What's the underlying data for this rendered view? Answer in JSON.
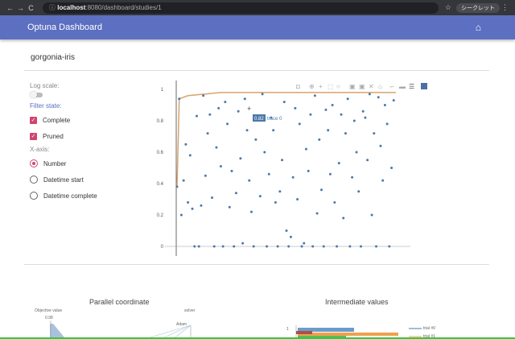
{
  "browser": {
    "url_host": "localhost",
    "url_rest": ":8080/dashboard/studies/1",
    "profile": "シークレット"
  },
  "appbar": {
    "title": "Optuna Dashboard",
    "home_icon": "home-icon"
  },
  "study": {
    "name": "gorgonia-iris"
  },
  "controls": {
    "log_scale_label": "Log scale:",
    "filter_label": "Filter state:",
    "complete": "Complete",
    "pruned": "Pruned",
    "xaxis_label": "X-axis:",
    "xaxis_options": [
      "Number",
      "Datetime start",
      "Datetime complete"
    ],
    "selected_xaxis": "Number"
  },
  "chart_data": {
    "type": "scatter",
    "title": "",
    "ylim": [
      0,
      1
    ],
    "xlim": [
      0,
      100
    ],
    "yticks": [
      "0",
      "0.2",
      "0.4",
      "0.6",
      "0.8",
      "1"
    ],
    "hover": {
      "value": "0.82",
      "trace": "trace 0"
    },
    "best_line": {
      "x": [
        0,
        1,
        5,
        20,
        100
      ],
      "y": [
        0.38,
        0.94,
        0.96,
        0.98,
        0.98
      ]
    },
    "color_points": "#4c78a8",
    "color_line": "#d8a36c",
    "values": [
      0.38,
      0.94,
      0.2,
      0.42,
      0.65,
      0.28,
      0.58,
      0.24,
      0,
      0.83,
      0,
      0.26,
      0.96,
      0.45,
      0.72,
      0.84,
      0.31,
      0,
      0.63,
      0.88,
      0.51,
      0,
      0.92,
      0.78,
      0.25,
      0.48,
      0,
      0.34,
      0.86,
      0.56,
      0.02,
      0.94,
      0.74,
      0.42,
      0.22,
      0,
      0.68,
      0.82,
      0.32,
      0.97,
      0.6,
      0,
      0.46,
      0.82,
      0.74,
      0.28,
      0,
      0.35,
      0.55,
      0.92,
      0.1,
      0,
      0.06,
      0.44,
      0.88,
      0.3,
      0.78,
      0,
      0.02,
      0.62,
      0.48,
      0.84,
      0,
      0.96,
      0.21,
      0.68,
      0.36,
      0,
      0.87,
      0.74,
      0.46,
      0.9,
      0.28,
      0,
      0.53,
      0.84,
      0.18,
      0.72,
      0.94,
      0,
      0.44,
      0.8,
      0.6,
      0.35,
      0,
      0.86,
      0.82,
      0.55,
      0.97,
      0.2,
      0.72,
      0,
      0.95,
      0.64,
      0.42,
      0.9,
      0.78,
      0,
      0.5,
      0.93
    ]
  },
  "sections": {
    "parallel": "Parallel coordinate",
    "intermediate": "Intermediate values",
    "objective": "Objective value",
    "obj_val": "0.98",
    "solver": "solver",
    "adam": "Adam",
    "iv_tick": "1",
    "legend": [
      "trial #0",
      "trial #1"
    ]
  }
}
